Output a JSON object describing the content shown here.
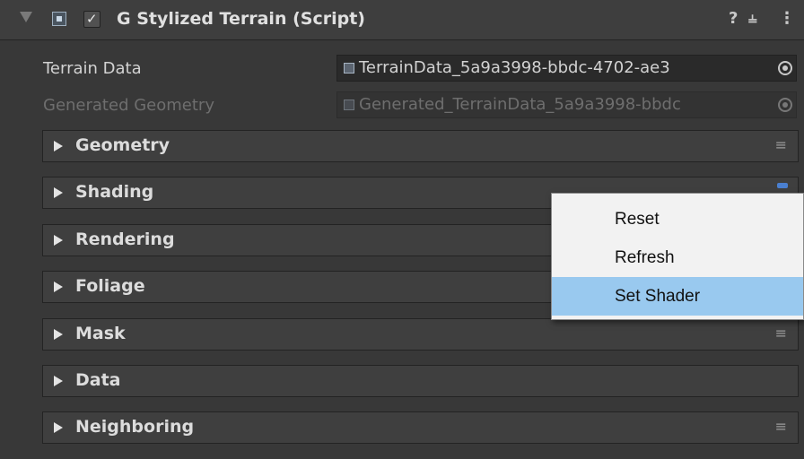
{
  "component": {
    "title": "G Stylized Terrain (Script)",
    "enabled": true,
    "help_icon": "help-icon",
    "presets_icon": "presets-icon",
    "more_icon": "kebab-menu-icon"
  },
  "fields": {
    "terrain_data_label": "Terrain Data",
    "terrain_data_value": "TerrainData_5a9a3998-bbdc-4702-ae3",
    "generated_geometry_label": "Generated Geometry",
    "generated_geometry_value": "Generated_TerrainData_5a9a3998-bbdc"
  },
  "sections": [
    {
      "label": "Geometry",
      "has_menu": true
    },
    {
      "label": "Shading",
      "has_menu": true
    },
    {
      "label": "Rendering",
      "has_menu": false
    },
    {
      "label": "Foliage",
      "has_menu": false
    },
    {
      "label": "Mask",
      "has_menu": true
    },
    {
      "label": "Data",
      "has_menu": false
    },
    {
      "label": "Neighboring",
      "has_menu": true
    }
  ],
  "context_menu": {
    "items": [
      "Reset",
      "Refresh",
      "Set Shader"
    ],
    "highlighted": "Set Shader"
  },
  "colors": {
    "background": "#383838",
    "menu_highlight": "#99c9ef"
  }
}
